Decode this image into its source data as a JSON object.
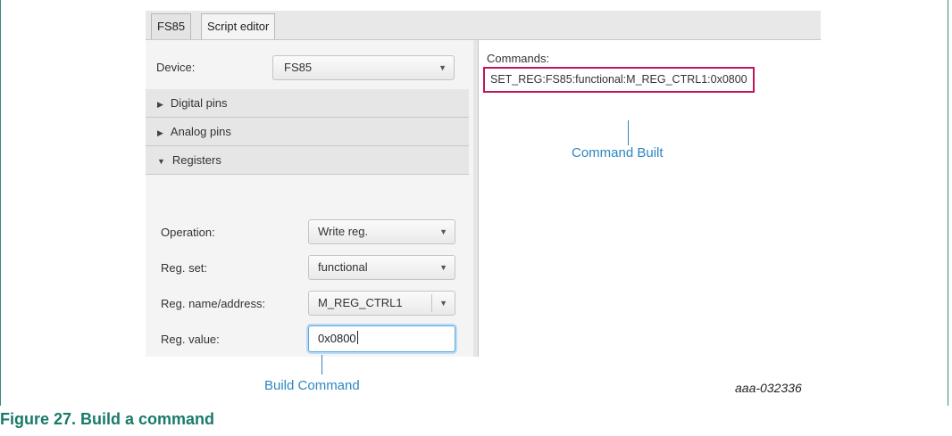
{
  "tabs": [
    "FS85",
    "Script editor"
  ],
  "device": {
    "label": "Device:",
    "value": "FS85"
  },
  "sections": {
    "digital": "Digital pins",
    "analog": "Analog pins",
    "registers": "Registers"
  },
  "registers": {
    "operation_label": "Operation:",
    "operation_value": "Write reg.",
    "regset_label": "Reg. set:",
    "regset_value": "functional",
    "regname_label": "Reg. name/address:",
    "regname_value": "M_REG_CTRL1",
    "regvalue_label": "Reg. value:",
    "regvalue_value": "0x0800"
  },
  "commands": {
    "label": "Commands:",
    "text": "SET_REG:FS85:functional:M_REG_CTRL1:0x0800"
  },
  "annotations": {
    "command_built": "Command Built",
    "build_command": "Build Command"
  },
  "figure_id": "aaa-032336",
  "caption": "Figure 27.  Build a command",
  "colors": {
    "frame": "#2f8f7f",
    "caption": "#1a7a6a",
    "annotation": "#2e86c1",
    "highlight": "#c4145a",
    "focus": "#5aa8e0"
  }
}
